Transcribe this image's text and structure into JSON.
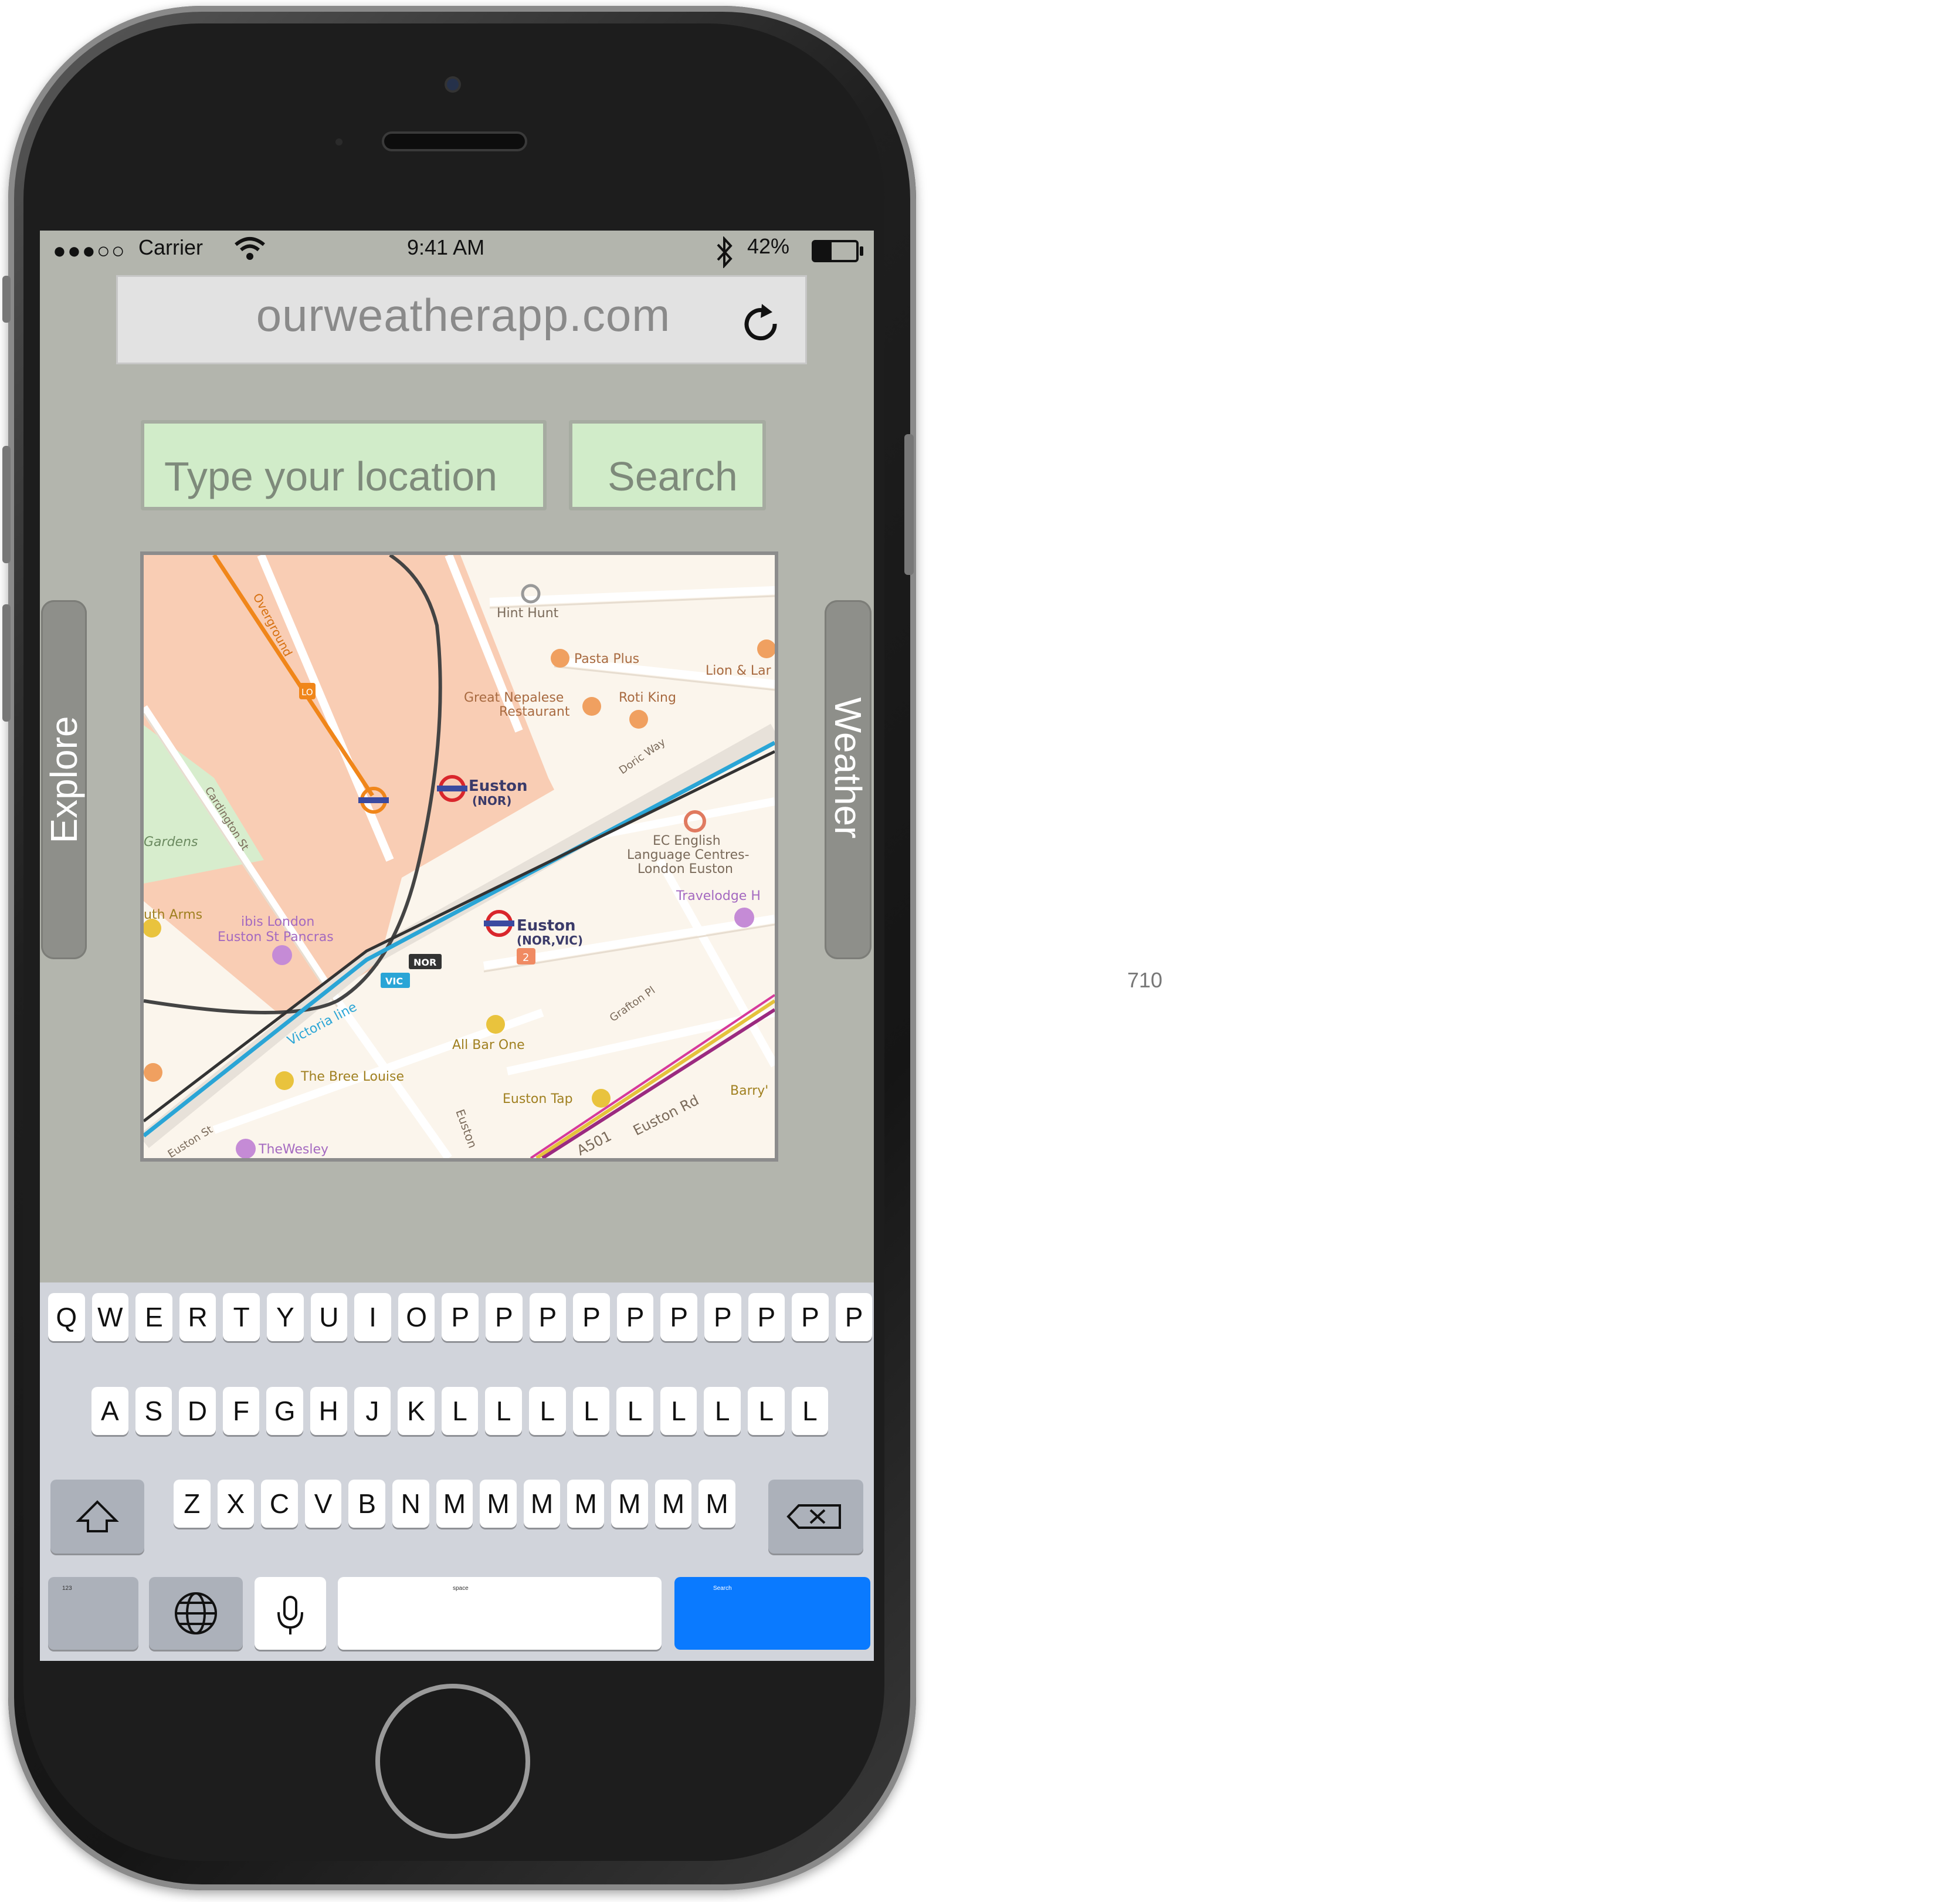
{
  "status_bar": {
    "signal": "●●●○○",
    "carrier": "Carrier",
    "time": "9:41 AM",
    "battery_percent": "42%",
    "battery_level": 0.42
  },
  "url_bar": {
    "url": "ourweatherapp.com",
    "reload_icon": "reload-icon"
  },
  "search": {
    "placeholder": "Type your location",
    "button_label": "Search"
  },
  "drawers": {
    "left_label": "Explore",
    "right_label": "Weather"
  },
  "map": {
    "labels": {
      "hint_hunt": "Hint Hunt",
      "pasta_plus": "Pasta Plus",
      "lion_lamb": "Lion & Lar",
      "great_nepalese_1": "Great Nepalese",
      "great_nepalese_2": "Restaurant",
      "roti_king": "Roti King",
      "doric_way": "Doric Way",
      "overground": "Overground",
      "lo_badge": "LO",
      "euston_nor_1": "Euston",
      "euston_nor_2": "(NOR)",
      "cardington": "Cardington St",
      "gardens": "Gardens",
      "ec_english_1": "EC English",
      "ec_english_2": "Language Centres-",
      "ec_english_3": "London Euston",
      "travelodge": "Travelodge H",
      "arms": "uth Arms",
      "ibis_1": "ibis London",
      "ibis_2": "Euston St Pancras",
      "euston_vic_1": "Euston",
      "euston_vic_2": "(NOR,VIC)",
      "nor_badge": "NOR",
      "vic_badge": "VIC",
      "victoria_line": "Victoria line",
      "badge_2": "2",
      "grafton_pl": "Grafton Pl",
      "all_bar_one": "All Bar One",
      "bree_louise": "The Bree Louise",
      "euston_tap": "Euston Tap",
      "barry": "Barry'",
      "euston_rd": "Euston Rd",
      "a501": "A501",
      "euston_st": "Euston St",
      "the_wesley": "TheWesley",
      "euston_road_v": "Euston"
    }
  },
  "keyboard": {
    "row1": [
      "Q",
      "W",
      "E",
      "R",
      "T",
      "Y",
      "U",
      "I",
      "O",
      "P",
      "P",
      "P",
      "P",
      "P",
      "P",
      "P",
      "P",
      "P",
      "P"
    ],
    "row2": [
      "A",
      "S",
      "D",
      "F",
      "G",
      "H",
      "J",
      "K",
      "L",
      "L",
      "L",
      "L",
      "L",
      "L",
      "L",
      "L",
      "L"
    ],
    "row3": [
      "Z",
      "X",
      "C",
      "V",
      "B",
      "N",
      "M",
      "M",
      "M",
      "M",
      "M",
      "M",
      "M"
    ],
    "numbers_label": "123",
    "space_label": "space",
    "return_label": "Search"
  },
  "page_number": "710",
  "colors": {
    "screen_bg": "#b3b5ad",
    "field_bg": "#d1ecc9",
    "return_key": "#0a7aff",
    "map_zone": "#f9cdb4"
  }
}
